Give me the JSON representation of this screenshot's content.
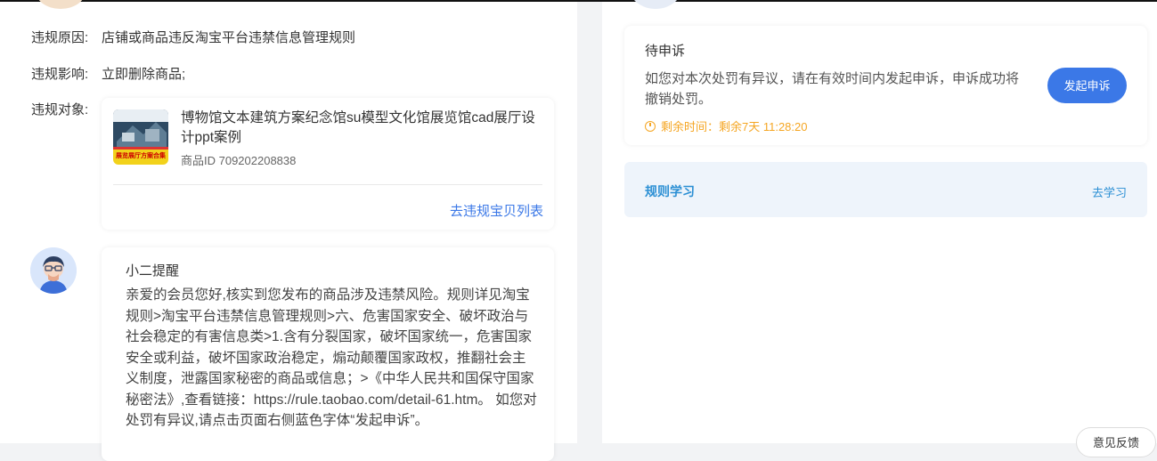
{
  "violation": {
    "reason_label": "违规原因:",
    "reason_value": "店铺或商品违反淘宝平台违禁信息管理规则",
    "impact_label": "违规影响:",
    "impact_value": "立即删除商品;",
    "object_label": "违规对象:"
  },
  "product": {
    "title": "博物馆文本建筑方案纪念馆su模型文化馆展览馆cad展厅设计ppt案例",
    "id_text": "商品ID 709202208838",
    "thumb_caption": "展览展厅方案合集",
    "list_link": "去违规宝贝列表"
  },
  "message": {
    "title": "小二提醒",
    "body": "亲爱的会员您好,核实到您发布的商品涉及违禁风险。规则详见淘宝规则>淘宝平台违禁信息管理规则>六、危害国家安全、破坏政治与社会稳定的有害信息类>1.含有分裂国家，破坏国家统一，危害国家安全或利益，破坏国家政治稳定，煽动颠覆国家政权，推翻社会主义制度，泄露国家秘密的商品或信息；>《中华人民共和国保守国家秘密法》,查看链接：https://rule.taobao.com/detail-61.htm。 如您对处罚有异议,请点击页面右侧蓝色字体“发起申诉”。"
  },
  "appeal": {
    "title": "待申诉",
    "desc": "如您对本次处罚有异议，请在有效时间内发起申诉，申诉成功将撤销处罚。",
    "time_text": "剩余时间：剩余7天 11:28:20",
    "button_label": "发起申诉"
  },
  "rules": {
    "title": "规则学习",
    "link": "去学习"
  },
  "feedback": {
    "label": "意见反馈"
  },
  "colors": {
    "accent_blue": "#3b78e7",
    "warning_orange": "#f5a623",
    "rule_blue": "#2b8fd4",
    "rule_bg": "#eef4fb"
  }
}
